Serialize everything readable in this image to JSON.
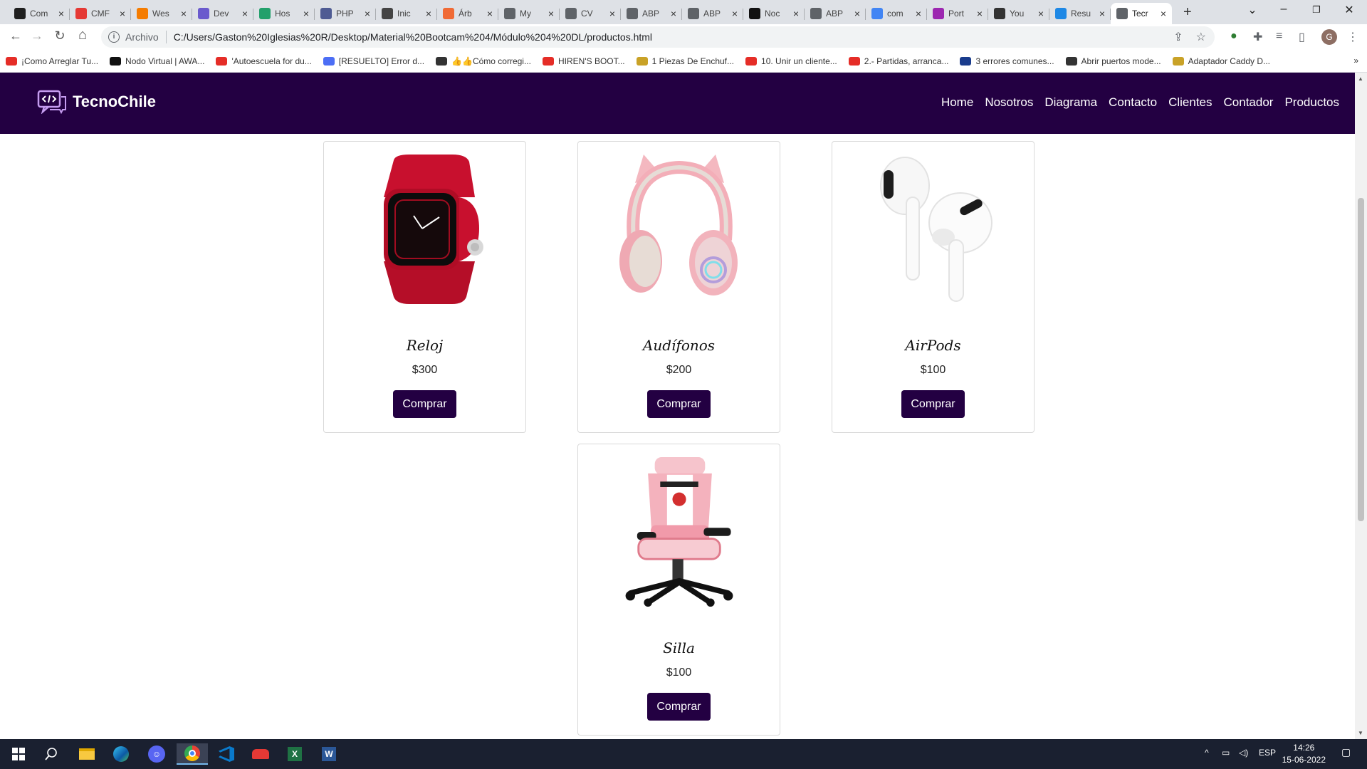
{
  "browser": {
    "tabs": [
      {
        "title": "Com",
        "fav_color": "#1f1f1f"
      },
      {
        "title": "CMF",
        "fav_color": "#e53935"
      },
      {
        "title": "Wes",
        "fav_color": "#f57c00"
      },
      {
        "title": "Dev",
        "fav_color": "#6a5acd"
      },
      {
        "title": "Hos",
        "fav_color": "#22a06b"
      },
      {
        "title": "PHP",
        "fav_color": "#4f5b93"
      },
      {
        "title": "Inic",
        "fav_color": "#444444"
      },
      {
        "title": "Árb",
        "fav_color": "#f06a35"
      },
      {
        "title": "My",
        "fav_color": "#5f6368"
      },
      {
        "title": "CV",
        "fav_color": "#5f6368"
      },
      {
        "title": "ABP",
        "fav_color": "#5f6368"
      },
      {
        "title": "ABP",
        "fav_color": "#5f6368"
      },
      {
        "title": "Noc",
        "fav_color": "#111111"
      },
      {
        "title": "ABP",
        "fav_color": "#5f6368"
      },
      {
        "title": "com",
        "fav_color": "#4285f4"
      },
      {
        "title": "Port",
        "fav_color": "#9c27b0"
      },
      {
        "title": "You",
        "fav_color": "#333333"
      },
      {
        "title": "Resu",
        "fav_color": "#1e88e5"
      },
      {
        "title": "Tecr",
        "fav_color": "#5f6368",
        "active": true
      }
    ],
    "new_tab": "+",
    "window_controls": {
      "minimize": "–",
      "maximize": "❐",
      "close": "✕"
    },
    "nav": {
      "back": "←",
      "forward": "→",
      "reload": "↻",
      "home": "⌂"
    },
    "address": {
      "scheme_label": "Archivo",
      "url": "C:/Users/Gaston%20Iglesias%20R/Desktop/Material%20Bootcam%204/Módulo%204%20DL/productos.html"
    },
    "profile_initial": "G",
    "bookmarks": [
      {
        "label": "¡Como Arreglar Tu...",
        "color": "#e52d27"
      },
      {
        "label": "Nodo Virtual | AWA...",
        "color": "#111111"
      },
      {
        "label": "'Autoescuela for du...",
        "color": "#e52d27"
      },
      {
        "label": "[RESUELTO] Error d...",
        "color": "#4c6ef5"
      },
      {
        "label": "👍👍Cómo corregi...",
        "color": "#333333"
      },
      {
        "label": "HIREN'S BOOT...",
        "color": "#e52d27"
      },
      {
        "label": "1 Piezas De Enchuf...",
        "color": "#c9a227"
      },
      {
        "label": "10. Unir un cliente...",
        "color": "#e52d27"
      },
      {
        "label": "2.- Partidas, arranca...",
        "color": "#e52d27"
      },
      {
        "label": "3 errores comunes...",
        "color": "#1a3c8c"
      },
      {
        "label": "Abrir puertos mode...",
        "color": "#333333"
      },
      {
        "label": "Adaptador Caddy D...",
        "color": "#c9a227"
      }
    ],
    "bookmarks_more": "»"
  },
  "site": {
    "brand": "TecnoChile",
    "nav_links": [
      "Home",
      "Nosotros",
      "Diagrama",
      "Contacto",
      "Clientes",
      "Contador",
      "Productos"
    ],
    "colors": {
      "primary": "#230042"
    },
    "products": [
      {
        "name": "Reloj",
        "price": "$300",
        "button": "Comprar",
        "image": "smartwatch-image"
      },
      {
        "name": "Audífonos",
        "price": "$200",
        "button": "Comprar",
        "image": "headphones-image"
      },
      {
        "name": "AirPods",
        "price": "$100",
        "button": "Comprar",
        "image": "airpods-image"
      },
      {
        "name": "Silla",
        "price": "$100",
        "button": "Comprar",
        "image": "gaming-chair-image"
      }
    ]
  },
  "taskbar": {
    "language": "ESP",
    "time": "14:26",
    "date": "15-06-2022"
  }
}
